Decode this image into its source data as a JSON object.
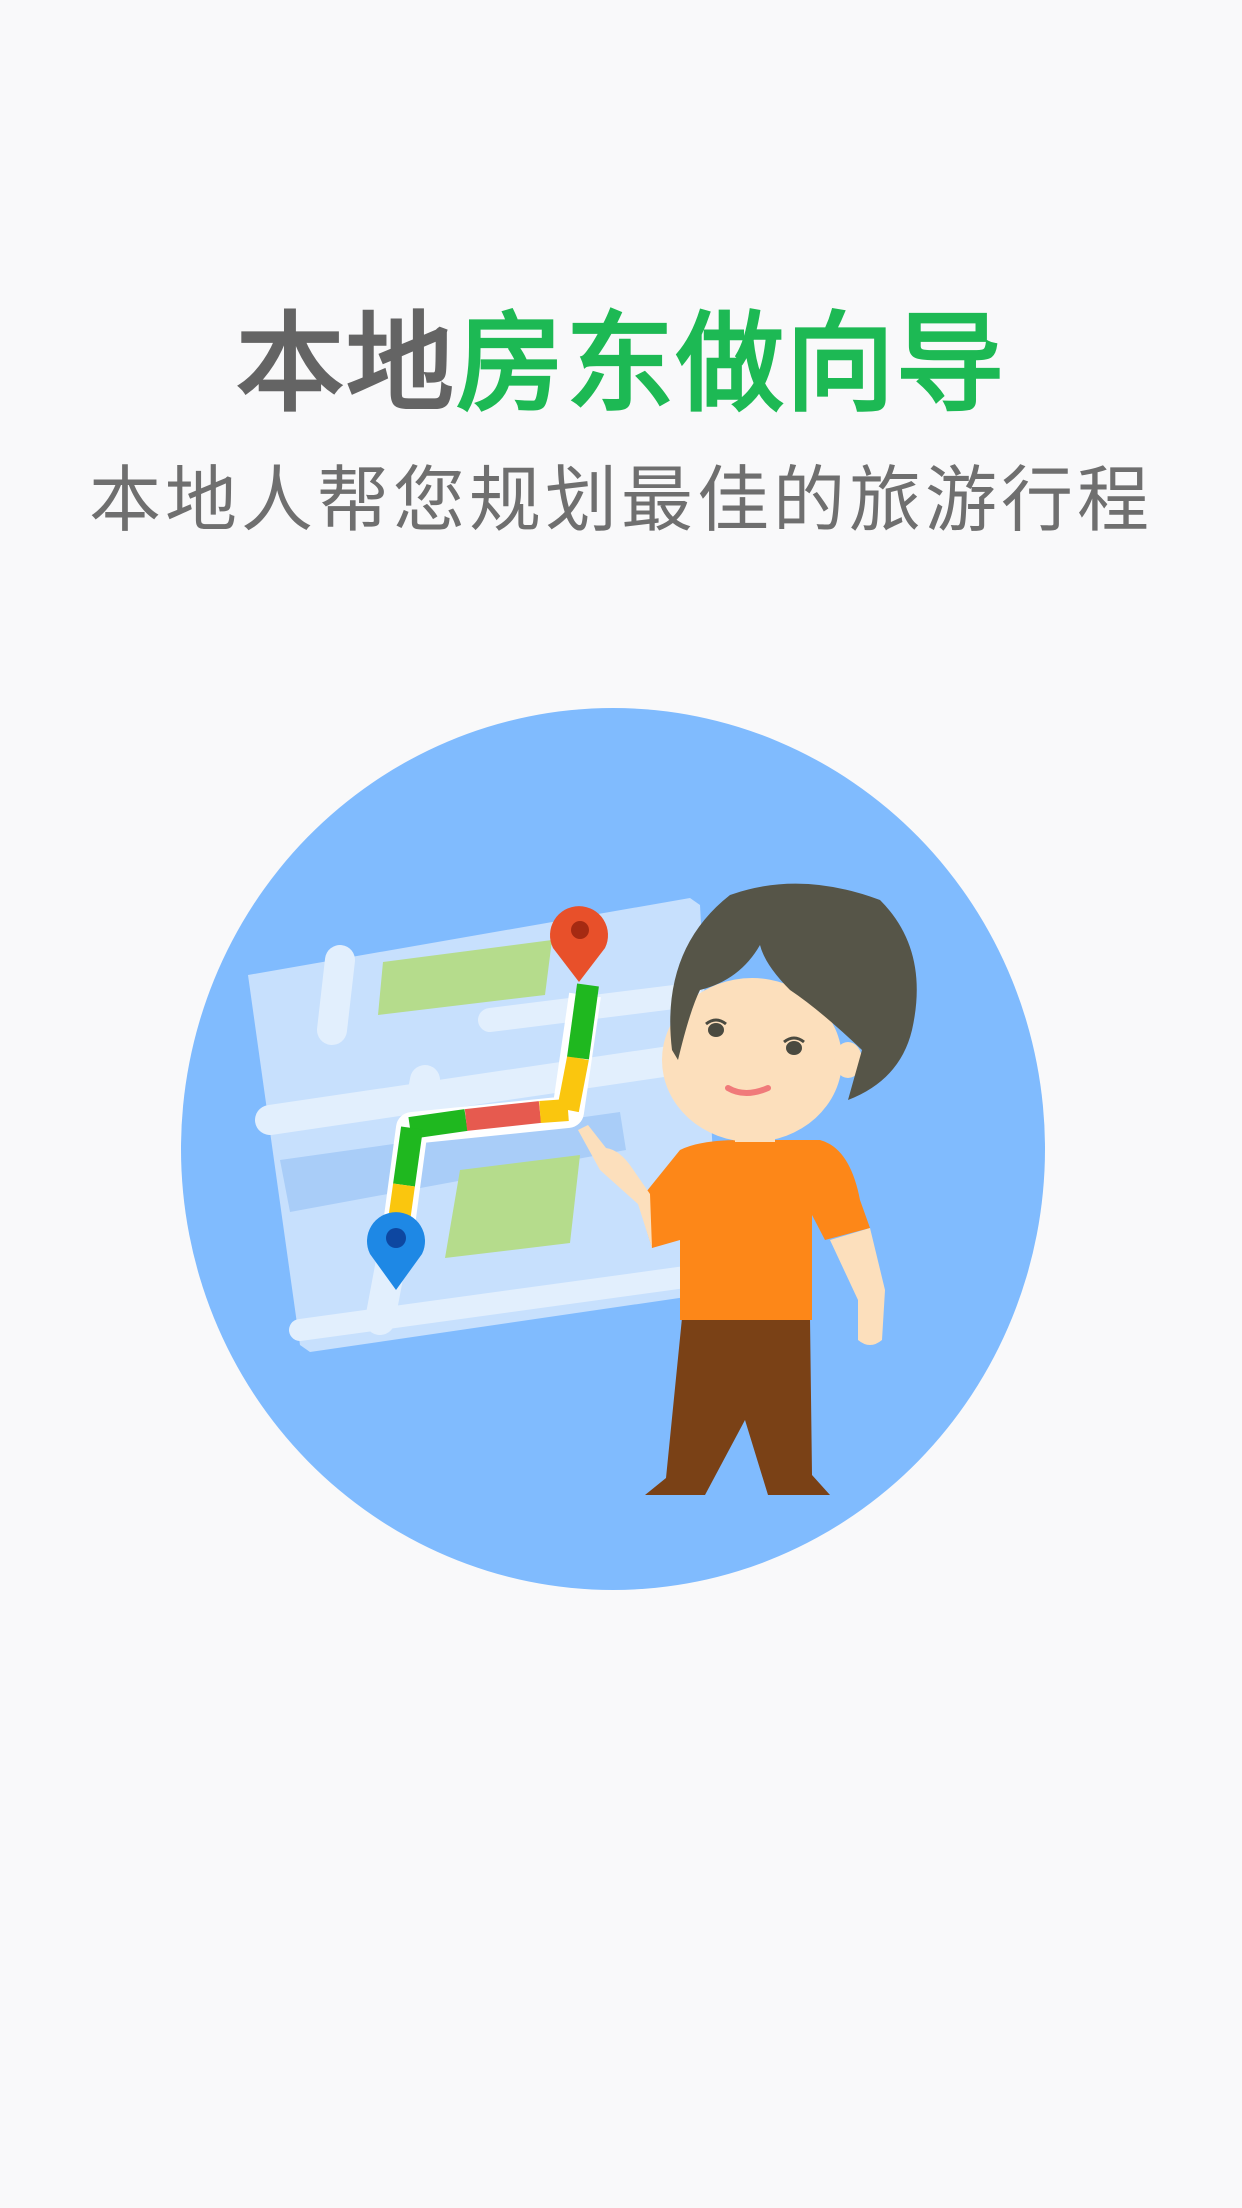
{
  "headline": {
    "plain": "本地",
    "accent": "房东做向导"
  },
  "subline": "本地人帮您规划最佳的旅游行程",
  "illustration": {
    "name": "local-guide-map-illustration",
    "colors": {
      "circle": "#80bbfe",
      "map": "#c7e0fd",
      "park": "#b5dc8c",
      "route_green": "#1fb81f",
      "route_red": "#e65a4f",
      "route_yellow": "#fac60e",
      "start_pin": "#1e88e5",
      "end_pin": "#e8502a",
      "hair": "#565548",
      "skin": "#fcdfbc",
      "shirt": "#fd8718",
      "pants": "#7a4116"
    }
  }
}
